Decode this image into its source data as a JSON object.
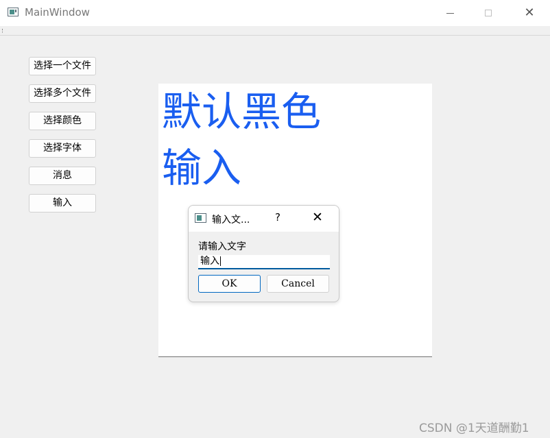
{
  "window": {
    "title": "MainWindow",
    "minimize_label": "",
    "maximize_label": "",
    "close_label": "✕"
  },
  "sidebar": {
    "buttons": [
      {
        "label": "选择一个文件"
      },
      {
        "label": "选择多个文件"
      },
      {
        "label": "选择颜色"
      },
      {
        "label": "选择字体"
      },
      {
        "label": "消息"
      },
      {
        "label": "输入"
      }
    ]
  },
  "canvas": {
    "line1": "默认黑色",
    "line2": "输入",
    "text_color": "#1a5ef0"
  },
  "dialog": {
    "title": "输入文...",
    "help_label": "?",
    "close_label": "✕",
    "prompt": "请输入文字",
    "input_value": "输入",
    "ok_label": "OK",
    "cancel_label": "Cancel"
  },
  "watermark": {
    "text": "CSDN @1天道酬勤1"
  }
}
